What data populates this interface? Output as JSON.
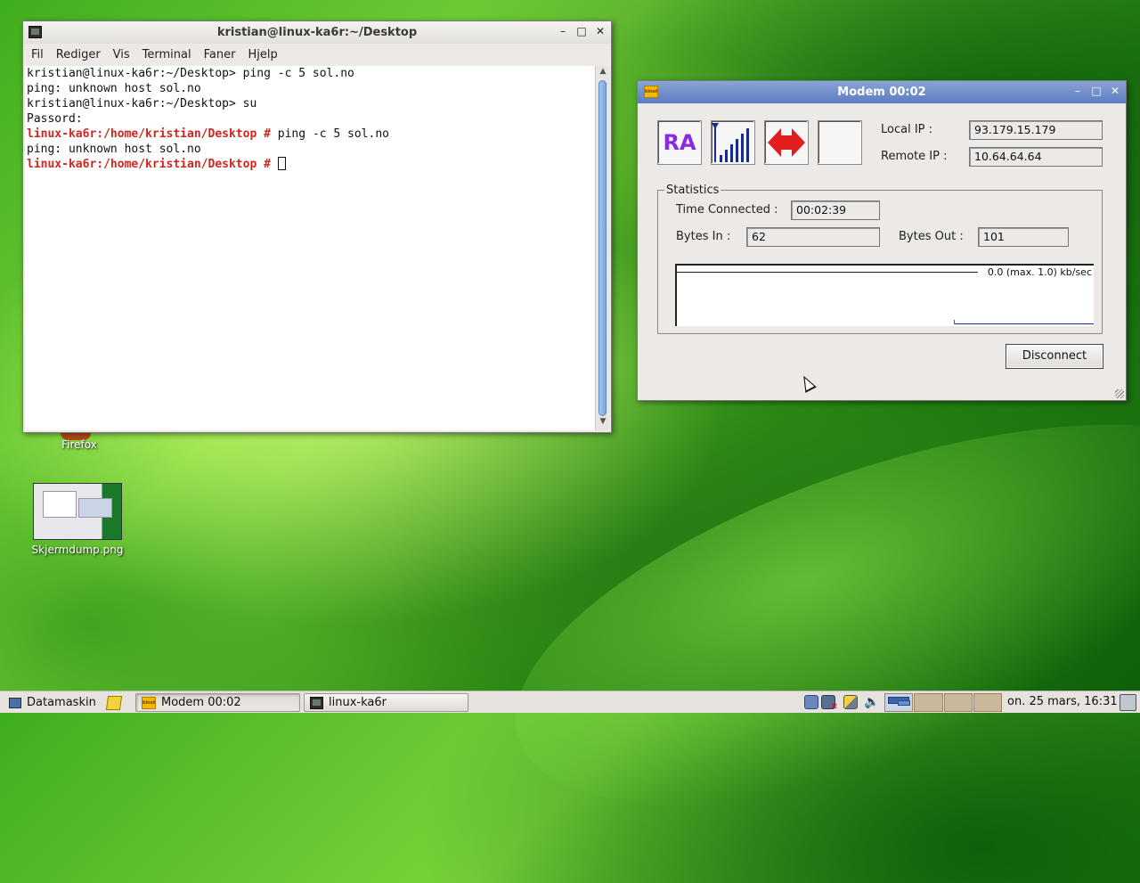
{
  "desktop": {
    "icons": [
      {
        "label": "Firefox"
      },
      {
        "label": "Skjermdump.png"
      }
    ]
  },
  "terminal": {
    "title": "kristian@linux-ka6r:~/Desktop",
    "menu": [
      "Fil",
      "Rediger",
      "Vis",
      "Terminal",
      "Faner",
      "Hjelp"
    ],
    "lines": [
      {
        "prompt": "kristian@linux-ka6r:~/Desktop> ",
        "command": "ping -c 5 sol.no"
      },
      {
        "output": "ping: unknown host sol.no"
      },
      {
        "prompt": "kristian@linux-ka6r:~/Desktop> ",
        "command": "su"
      },
      {
        "output": "Passord:"
      },
      {
        "root_prompt": "linux-ka6r:/home/kristian/Desktop # ",
        "command": "ping -c 5 sol.no"
      },
      {
        "output": "ping: unknown host sol.no"
      },
      {
        "root_prompt": "linux-ka6r:/home/kristian/Desktop # ",
        "command": ""
      }
    ]
  },
  "modem": {
    "title": "Modem 00:02",
    "ra_label": "RA",
    "local_ip_label": "Local IP :",
    "local_ip": "93.179.15.179",
    "remote_ip_label": "Remote IP :",
    "remote_ip": "10.64.64.64",
    "statistics_label": "Statistics",
    "time_connected_label": "Time Connected :",
    "time_connected": "00:02:39",
    "bytes_in_label": "Bytes In :",
    "bytes_in": "62",
    "bytes_out_label": "Bytes Out :",
    "bytes_out": "101",
    "rate_text": "0.0 (max. 1.0) kb/sec",
    "disconnect_label": "Disconnect",
    "colors": {
      "ra": "#8a2be2",
      "arrows": "#e11d1d",
      "signal": "#1a2a8a"
    }
  },
  "taskbar": {
    "start_label": "Datamaskin",
    "tasks": [
      {
        "label": "Modem 00:02",
        "icon": "kinternet-icon"
      },
      {
        "label": "linux-ka6r",
        "icon": "terminal-icon"
      }
    ],
    "clock": "on. 25 mars, 16:31"
  }
}
